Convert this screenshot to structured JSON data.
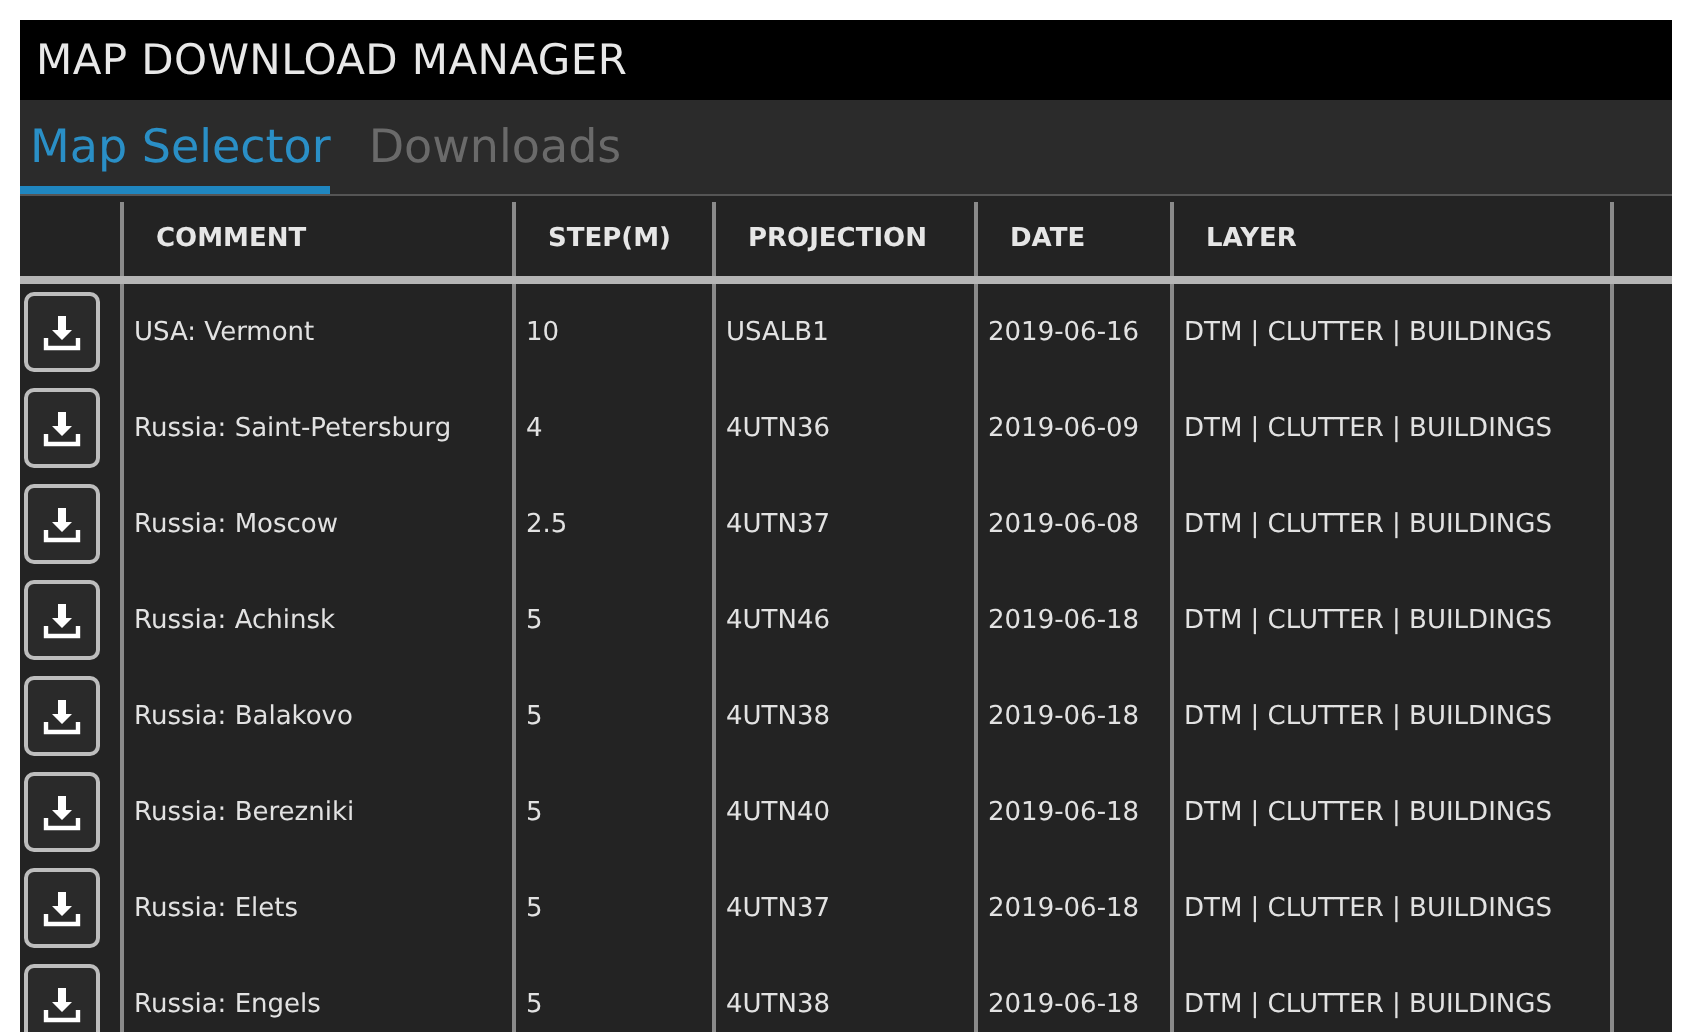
{
  "window": {
    "title": "MAP DOWNLOAD MANAGER"
  },
  "tabs": [
    {
      "label": "Map Selector",
      "selected": true
    },
    {
      "label": "Downloads",
      "selected": false
    }
  ],
  "table": {
    "columns": [
      "COMMENT",
      "STEP(M)",
      "PROJECTION",
      "DATE",
      "LAYER"
    ],
    "rows": [
      {
        "comment": "USA: Vermont",
        "step": "10",
        "projection": "USALB1",
        "date": "2019-06-16",
        "layer": "DTM | CLUTTER | BUILDINGS"
      },
      {
        "comment": "Russia: Saint-Petersburg",
        "step": "4",
        "projection": "4UTN36",
        "date": "2019-06-09",
        "layer": "DTM | CLUTTER | BUILDINGS"
      },
      {
        "comment": "Russia: Moscow",
        "step": "2.5",
        "projection": "4UTN37",
        "date": "2019-06-08",
        "layer": "DTM | CLUTTER | BUILDINGS"
      },
      {
        "comment": "Russia: Achinsk",
        "step": "5",
        "projection": "4UTN46",
        "date": "2019-06-18",
        "layer": "DTM | CLUTTER | BUILDINGS"
      },
      {
        "comment": "Russia: Balakovo",
        "step": "5",
        "projection": "4UTN38",
        "date": "2019-06-18",
        "layer": "DTM | CLUTTER | BUILDINGS"
      },
      {
        "comment": "Russia: Berezniki",
        "step": "5",
        "projection": "4UTN40",
        "date": "2019-06-18",
        "layer": "DTM | CLUTTER | BUILDINGS"
      },
      {
        "comment": "Russia: Elets",
        "step": "5",
        "projection": "4UTN37",
        "date": "2019-06-18",
        "layer": "DTM | CLUTTER | BUILDINGS"
      },
      {
        "comment": "Russia: Engels",
        "step": "5",
        "projection": "4UTN38",
        "date": "2019-06-18",
        "layer": "DTM | CLUTTER | BUILDINGS"
      }
    ]
  }
}
